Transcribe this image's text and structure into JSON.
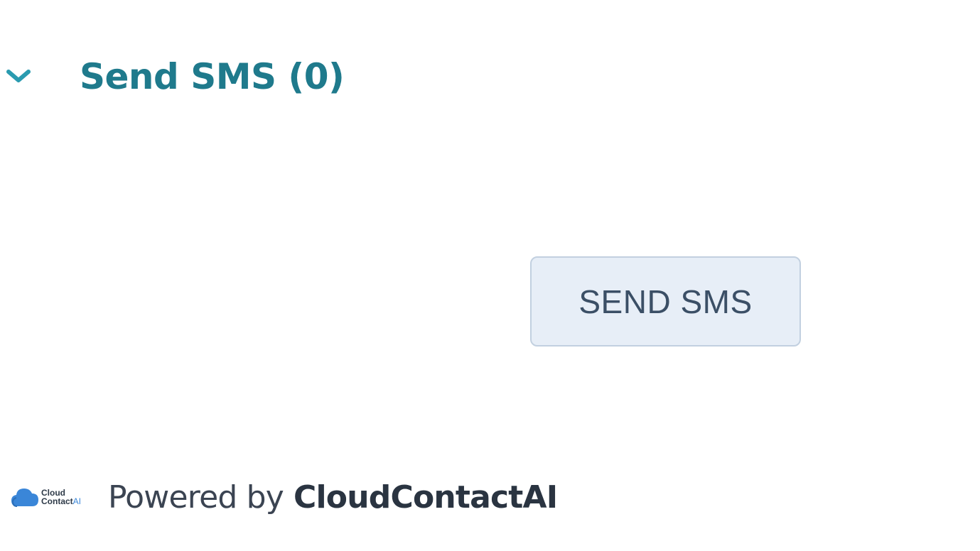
{
  "section": {
    "title": "Send SMS (0)",
    "expand_icon": "chevron-down-icon",
    "title_color": "#1f7a8c"
  },
  "actions": {
    "send_sms_label": "SEND SMS"
  },
  "footer": {
    "logo_icon": "cloud-icon",
    "logo_line1": "Cloud",
    "logo_line2": "Contact",
    "logo_line2_suffix": "AI",
    "powered_by": "Powered by",
    "brand": "CloudContactAI"
  },
  "colors": {
    "button_bg": "#e7eef7",
    "button_border": "#c2d0e0",
    "button_text": "#3b4f66",
    "logo_cloud": "#3a86d8"
  }
}
